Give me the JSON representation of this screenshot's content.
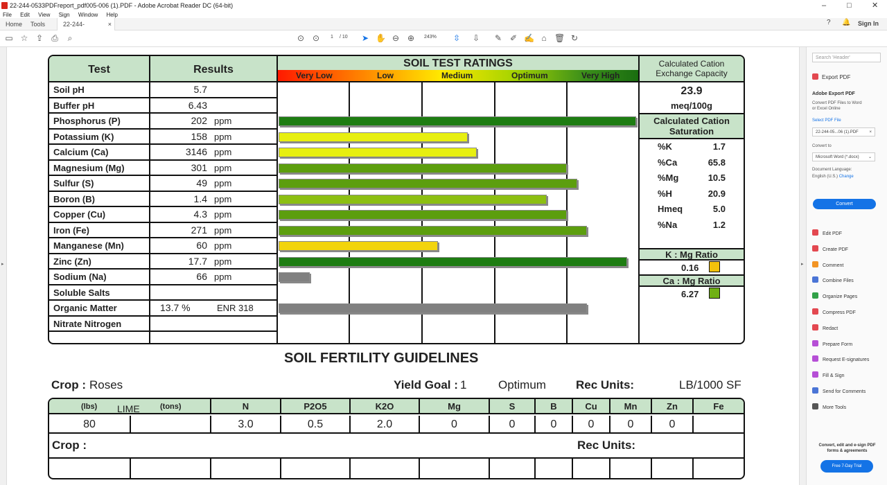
{
  "window": {
    "title": "22-244-0533PDFreport_pdf005-006 (1).PDF - Adobe Acrobat Reader DC (64-bit)",
    "menu": [
      "File",
      "Edit",
      "View",
      "Sign",
      "Window",
      "Help"
    ],
    "controls": [
      "–",
      "□",
      "✕"
    ]
  },
  "tabs": {
    "home": "Home",
    "tools": "Tools",
    "doc": "22-244-0533PDFr...",
    "sign_in": "Sign In"
  },
  "toolbar": {
    "page_current": "1",
    "page_total": "/ 10",
    "zoom": "243%"
  },
  "side_panel": {
    "search_placeholder": "Search 'Header'",
    "export_pdf": "Export PDF",
    "adobe_export": "Adobe Export PDF",
    "export_desc_1": "Convert PDF Files to Word",
    "export_desc_2": "or Excel Online",
    "select_file": "Select PDF File",
    "selected_file": "22-244-05...06 (1).PDF",
    "convert_to": "Convert to",
    "convert_option": "Microsoft Word (*.docx)",
    "doc_language": "Document Language:",
    "language": "English (U.S.)",
    "change": "Change",
    "convert_button": "Convert",
    "tools": [
      {
        "label": "Edit PDF",
        "color": "#e34850"
      },
      {
        "label": "Create PDF",
        "color": "#e34850"
      },
      {
        "label": "Comment",
        "color": "#f29423"
      },
      {
        "label": "Combine Files",
        "color": "#4b75d6"
      },
      {
        "label": "Organize Pages",
        "color": "#31a148"
      },
      {
        "label": "Compress PDF",
        "color": "#e34850"
      },
      {
        "label": "Redact",
        "color": "#e34850"
      },
      {
        "label": "Prepare Form",
        "color": "#b64fd6"
      },
      {
        "label": "Request E-signatures",
        "color": "#b64fd6"
      },
      {
        "label": "Fill & Sign",
        "color": "#b64fd6"
      },
      {
        "label": "Send for Comments",
        "color": "#4b75d6"
      },
      {
        "label": "More Tools",
        "color": "#555555"
      }
    ],
    "promo_1": "Convert, edit and e-sign PDF",
    "promo_2": "forms & agreements",
    "trial_button": "Free 7-Day Trial"
  },
  "report": {
    "test_header": "Test",
    "results_header": "Results",
    "ratings_title": "SOIL TEST RATINGS",
    "rating_labels": [
      "Very Low",
      "Low",
      "Medium",
      "Optimum",
      "Very High"
    ],
    "rows": [
      {
        "test": "Soil pH",
        "value": "5.7",
        "unit": "",
        "bar": null
      },
      {
        "test": "Buffer pH",
        "value": "6.43",
        "unit": "",
        "bar": null
      },
      {
        "test": "Phosphorus (P)",
        "value": "202",
        "unit": "ppm",
        "bar": {
          "level": 1.0,
          "color": "#1e7d12"
        }
      },
      {
        "test": "Potassium (K)",
        "value": "158",
        "unit": "ppm",
        "bar": {
          "level": 0.53,
          "color": "#e7ef10"
        }
      },
      {
        "test": "Calcium (Ca)",
        "value": "3146",
        "unit": "ppm",
        "bar": {
          "level": 0.555,
          "color": "#e7ef10"
        }
      },
      {
        "test": "Magnesium (Mg)",
        "value": "301",
        "unit": "ppm",
        "bar": {
          "level": 0.807,
          "color": "#5c9e0e"
        }
      },
      {
        "test": "Sulfur (S)",
        "value": "49",
        "unit": "ppm",
        "bar": {
          "level": 0.835,
          "color": "#5c9e0e"
        }
      },
      {
        "test": "Boron (B)",
        "value": "1.4",
        "unit": "ppm",
        "bar": {
          "level": 0.75,
          "color": "#8cbf12"
        }
      },
      {
        "test": "Copper (Cu)",
        "value": "4.3",
        "unit": "ppm",
        "bar": {
          "level": 0.807,
          "color": "#5c9e0e"
        }
      },
      {
        "test": "Iron (Fe)",
        "value": "271",
        "unit": "ppm",
        "bar": {
          "level": 0.862,
          "color": "#5c9e0e"
        }
      },
      {
        "test": "Manganese (Mn)",
        "value": "60",
        "unit": "ppm",
        "bar": {
          "level": 0.446,
          "color": "#f2d40c"
        }
      },
      {
        "test": "Zinc (Zn)",
        "value": "17.7",
        "unit": "ppm",
        "bar": {
          "level": 0.975,
          "color": "#1e7d12"
        }
      },
      {
        "test": "Sodium (Na)",
        "value": "66",
        "unit": "ppm",
        "bar": {
          "level": 0.087,
          "color": "#808080"
        }
      },
      {
        "test": "Soluble Salts",
        "value": "",
        "unit": "",
        "bar": null
      },
      {
        "test": "Organic Matter",
        "value": "13.7 %",
        "unit": "ENR  318",
        "bar": {
          "level": 0.862,
          "color": "#808080"
        }
      },
      {
        "test": "Nitrate Nitrogen",
        "value": "",
        "unit": "",
        "bar": null
      },
      {
        "test": "",
        "value": "",
        "unit": "",
        "bar": null
      }
    ],
    "cec_title_1": "Calculated Cation",
    "cec_title_2": "Exchange Capacity",
    "cec_value": "23.9",
    "cec_unit": "meq/100g",
    "sat_title_1": "Calculated Cation",
    "sat_title_2": "Saturation",
    "saturation": [
      {
        "k": "%K",
        "v": "1.7"
      },
      {
        "k": "%Ca",
        "v": "65.8"
      },
      {
        "k": "%Mg",
        "v": "10.5"
      },
      {
        "k": "%H",
        "v": "20.9"
      },
      {
        "k": "Hmeq",
        "v": "5.0"
      },
      {
        "k": "%Na",
        "v": "1.2"
      }
    ],
    "k_mg_title": "K : Mg Ratio",
    "k_mg_value": "0.16",
    "k_mg_color": "#f2c20c",
    "ca_mg_title": "Ca : Mg Ratio",
    "ca_mg_value": "6.27",
    "ca_mg_color": "#6fb014"
  },
  "guidelines": {
    "title": "SOIL FERTILITY GUIDELINES",
    "crop_label": "Crop :",
    "crop": "Roses",
    "yield_label": "Yield Goal :",
    "yield": "1",
    "yield_level": "Optimum",
    "rec_label": "Rec Units:",
    "rec_units": "LB/1000 SF",
    "lime_lbs": "(lbs)",
    "lime": "LIME",
    "lime_tons": "(tons)",
    "columns": [
      "N",
      "P2O5",
      "K2O",
      "Mg",
      "S",
      "B",
      "Cu",
      "Mn",
      "Zn",
      "Fe"
    ],
    "lime_value": "80",
    "values": [
      "3.0",
      "0.5",
      "2.0",
      "0",
      "0",
      "0",
      "0",
      "0",
      "0",
      ""
    ],
    "crop2_label": "Crop :",
    "rec2_label": "Rec Units:"
  }
}
